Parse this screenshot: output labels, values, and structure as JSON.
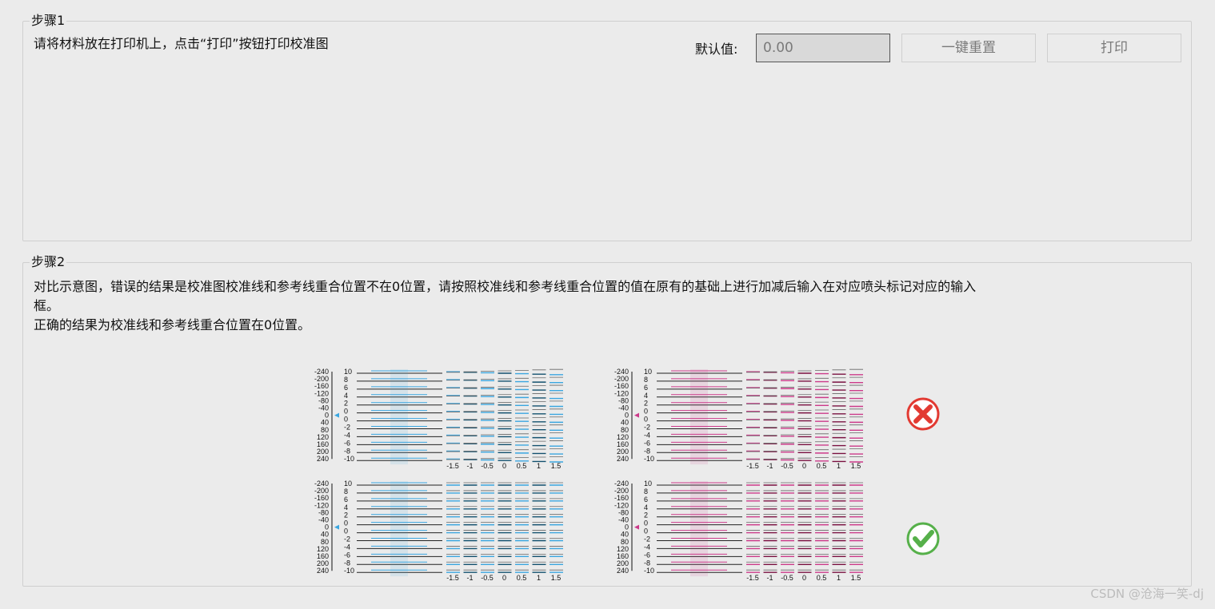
{
  "step1": {
    "title": "步骤1",
    "instruction": "请将材料放在打印机上，点击“打印”按钮打印校准图",
    "default_label": "默认值:",
    "default_value": "0.00",
    "reset_label": "一键重置",
    "print_label": "打印"
  },
  "step2": {
    "title": "步骤2",
    "instruction_line1": "对比示意图，错误的结果是校准图校准线和参考线重合位置不在0位置，请按照校准线和参考线重合位置的值在原有的基础上进行加减后输入在对应喷头标记对应的输入",
    "instruction_line1b": "框。",
    "instruction_line2": "正确的结果为校准线和参考线重合位置在0位置。"
  },
  "diagrams": {
    "left_scale": [
      "-240",
      "-200",
      "-160",
      "-120",
      "-80",
      "-40",
      "0",
      "40",
      "80",
      "120",
      "160",
      "200",
      "240"
    ],
    "right_scale": [
      "10",
      "8",
      "6",
      "4",
      "2",
      "0",
      "0",
      "-2",
      "-4",
      "-6",
      "-8",
      "-10"
    ],
    "x_ticks": [
      "-1.5",
      "-1",
      "-0.5",
      "0",
      "0.5",
      "1",
      "1.5"
    ],
    "colors": {
      "cyan": "#3aa6e0",
      "magenta": "#cc3a8a",
      "navy": "#12506e",
      "wine": "#7a1040",
      "ok": "#56b04a",
      "error": "#e23a32"
    }
  },
  "results": {
    "wrong_icon": "error-x-icon",
    "right_icon": "check-icon"
  },
  "watermark": "CSDN @沧海一笑-dj"
}
